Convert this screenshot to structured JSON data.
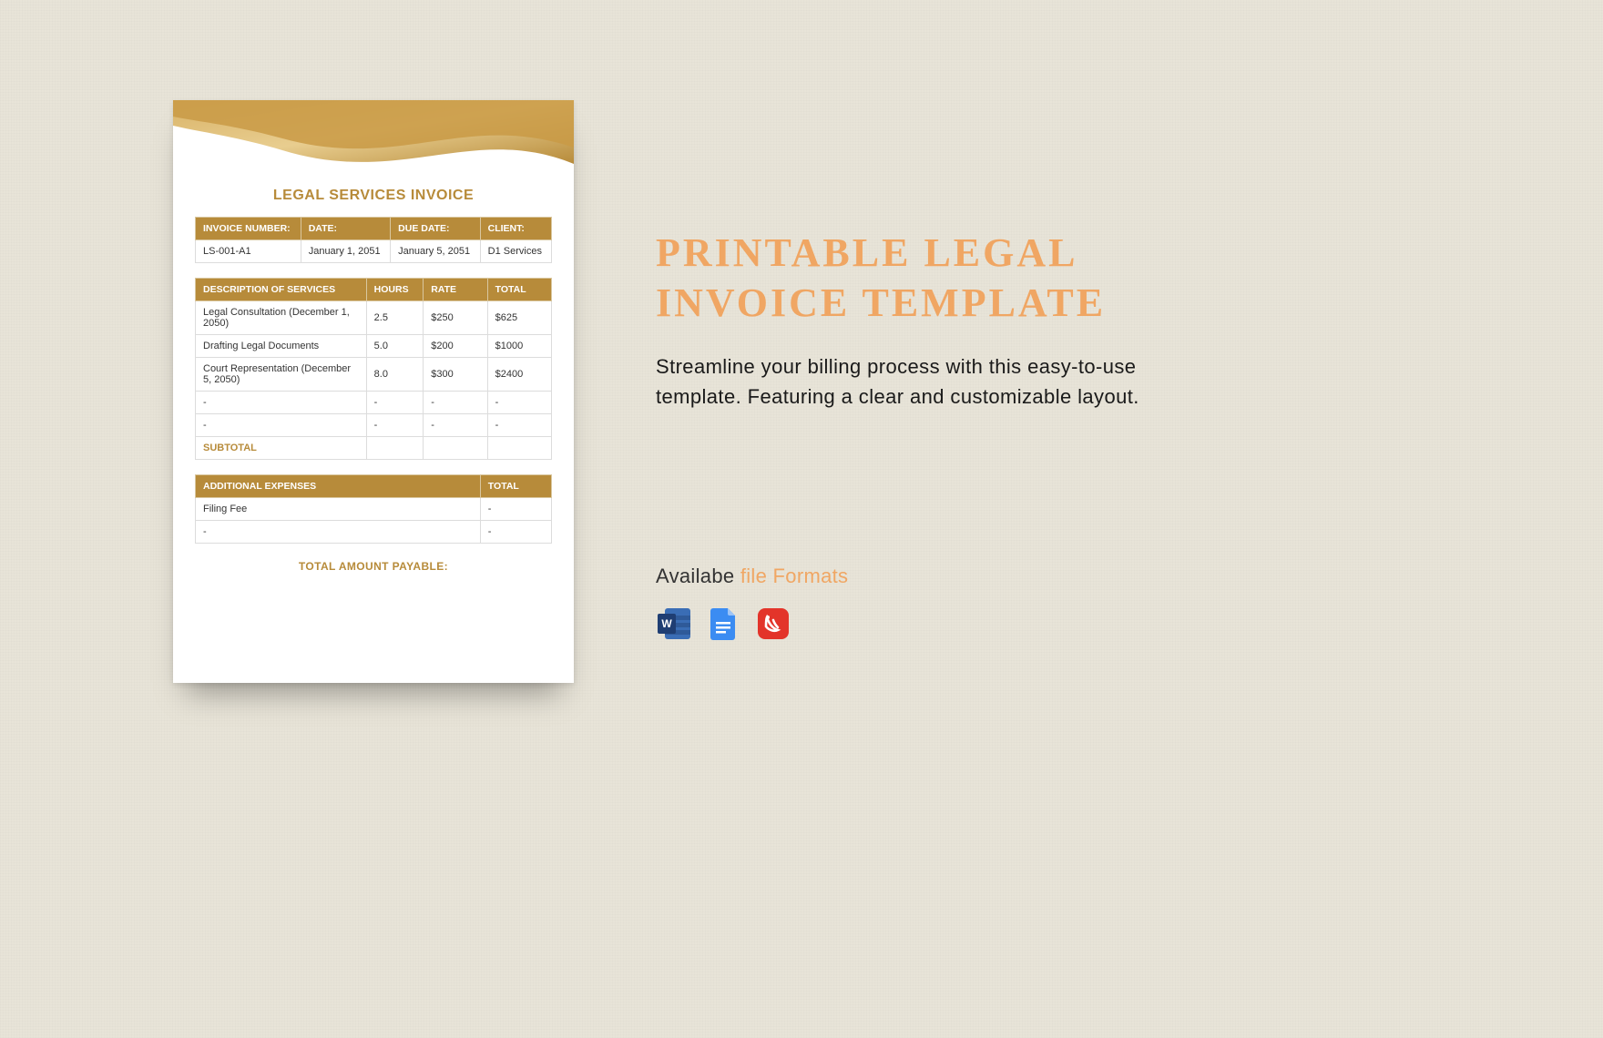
{
  "doc": {
    "title": "LEGAL SERVICES INVOICE",
    "meta_headers": {
      "inv_no": "INVOICE NUMBER:",
      "date": "DATE:",
      "due": "DUE DATE:",
      "client": "CLIENT:"
    },
    "meta_values": {
      "inv_no": "LS-001-A1",
      "date": "January 1, 2051",
      "due": "January 5, 2051",
      "client": "D1 Services"
    },
    "svc_headers": {
      "desc": "DESCRIPTION OF SERVICES",
      "hours": "HOURS",
      "rate": "RATE",
      "total": "TOTAL"
    },
    "services": [
      {
        "desc": "Legal Consultation (December 1, 2050)",
        "hours": "2.5",
        "rate": "$250",
        "total": "$625"
      },
      {
        "desc": "Drafting Legal Documents",
        "hours": "5.0",
        "rate": "$200",
        "total": "$1000"
      },
      {
        "desc": "Court Representation (December 5, 2050)",
        "hours": "8.0",
        "rate": "$300",
        "total": "$2400"
      },
      {
        "desc": "-",
        "hours": "-",
        "rate": "-",
        "total": "-"
      },
      {
        "desc": "-",
        "hours": "-",
        "rate": "-",
        "total": "-"
      }
    ],
    "subtotal_label": "SUBTOTAL",
    "exp_headers": {
      "desc": "ADDITIONAL EXPENSES",
      "total": "TOTAL"
    },
    "expenses": [
      {
        "desc": "Filing Fee",
        "total": "-"
      },
      {
        "desc": "-",
        "total": "-"
      }
    ],
    "total_label": "TOTAL AMOUNT PAYABLE:"
  },
  "info": {
    "title": "PRINTABLE LEGAL INVOICE TEMPLATE",
    "description": "Streamline your billing process with this easy-to-use template. Featuring a clear and customizable layout.",
    "formats_label_a": "Availabe ",
    "formats_label_b": "file Formats",
    "formats": [
      {
        "name": "word-icon"
      },
      {
        "name": "gdocs-icon"
      },
      {
        "name": "pdf-icon"
      }
    ]
  },
  "colors": {
    "gold": "#b78b3a",
    "accent": "#f0a663"
  }
}
